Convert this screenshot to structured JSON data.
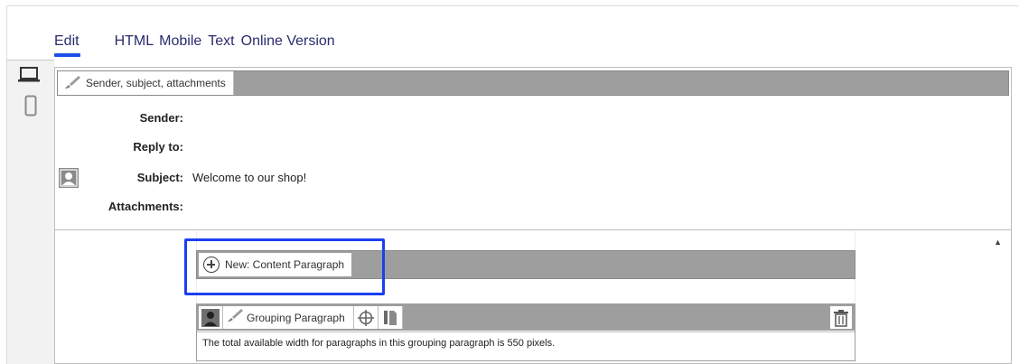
{
  "tabs": [
    {
      "label": "Edit",
      "active": true
    },
    {
      "label": "HTML"
    },
    {
      "label": "Mobile"
    },
    {
      "label": "Text"
    },
    {
      "label": "Online Version"
    }
  ],
  "devices": {
    "desktop_icon": "laptop-icon",
    "mobile_icon": "phone-icon"
  },
  "header": {
    "label": "Sender, subject, attachments",
    "icon": "brush-icon"
  },
  "fields": {
    "sender_label": "Sender:",
    "sender_value": "",
    "reply_label": "Reply to:",
    "reply_value": "",
    "subject_label": "Subject:",
    "subject_value": "Welcome to our shop!",
    "attachments_label": "Attachments:",
    "attachments_value": ""
  },
  "new_paragraph": {
    "label": "New: Content Paragraph",
    "icon": "plus-circle-icon"
  },
  "grouping": {
    "label": "Grouping Paragraph",
    "description": "The total available width for paragraphs in this grouping paragraph is 550 pixels."
  },
  "colors": {
    "accent": "#1c4fe6",
    "highlight": "#1c3ff0",
    "bar": "#9e9e9e"
  }
}
